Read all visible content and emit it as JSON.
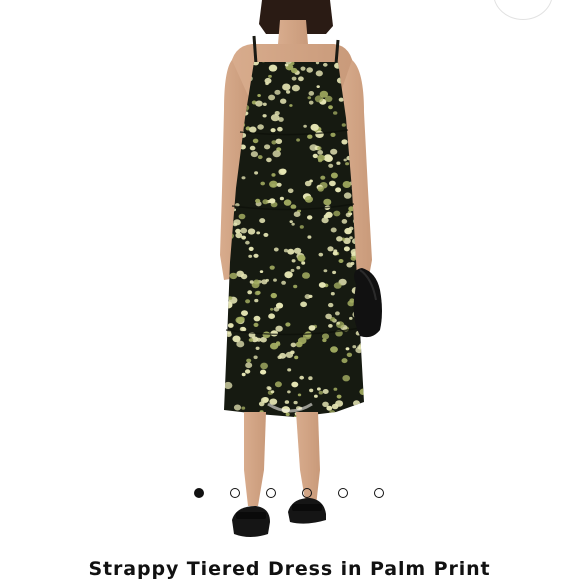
{
  "product": {
    "title": "Strappy Tiered Dress in Palm Print",
    "image_alt": "Model wearing strappy tiered dress in palm print"
  },
  "gallery": {
    "slide_count": 6,
    "active_index": 0
  },
  "icons": {
    "zoom": "magnify-icon"
  },
  "colors": {
    "background": "#ffffff",
    "dress_base": "#161a11",
    "print_light": "#e6e6b4",
    "print_green": "#a4ae62",
    "dot_active": "#111111"
  }
}
